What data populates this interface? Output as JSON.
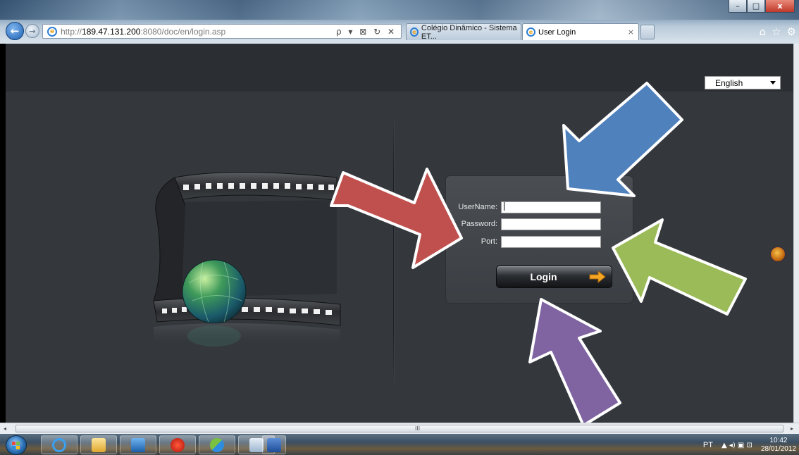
{
  "browser": {
    "address": {
      "prefix": "http://",
      "host": "189.47.131.200",
      "rest": ":8080/doc/en/login.asp",
      "tools": "ρ ▾ ⊠ ↻ ✕"
    },
    "tabs": [
      {
        "label": "Colégio Dinâmico - Sistema ET...",
        "active": false
      },
      {
        "label": "User Login",
        "active": true
      }
    ],
    "tab_close": "×",
    "window_buttons": {
      "minimize": "–",
      "maximize": "□",
      "close": "x"
    },
    "right_icons": {
      "home": "⌂",
      "favorites": "☆",
      "tools": "⚙"
    }
  },
  "page": {
    "language": {
      "selected": "English"
    },
    "login_form": {
      "username_label": "UserName:",
      "password_label": "Password:",
      "port_label": "Port:",
      "username_value": "",
      "password_value": "",
      "port_value": "",
      "login_button": "Login"
    }
  },
  "scrollbar": {
    "grip": "III",
    "left_arrow": "◂",
    "right_arrow": "▸"
  },
  "taskbar": {
    "tray": {
      "language": "PT",
      "symbols": "▲ ◂) ▣ ⊡",
      "time": "10:42",
      "date": "28/01/2012"
    }
  },
  "colors": {
    "page_bg": "#34383d",
    "arrow_red": "#c0504d",
    "arrow_blue": "#4f81bd",
    "arrow_green": "#9bbb59",
    "arrow_purple": "#8064a2"
  }
}
